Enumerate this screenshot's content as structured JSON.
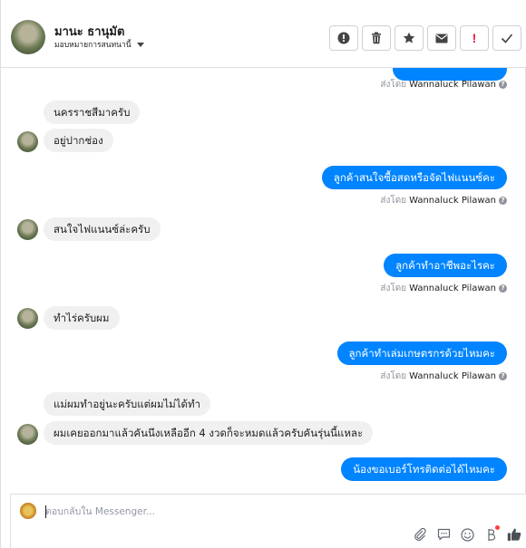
{
  "header": {
    "name": "มานะ ธานุมัต",
    "assign_label": "มอบหมายการสนทนานี้",
    "toolbar_icons": [
      "alert-circle-icon",
      "trash-icon",
      "star-icon",
      "mail-icon",
      "exclamation-icon",
      "checkmark-icon"
    ]
  },
  "messages": [
    {
      "dir": "out",
      "text": ""
    },
    {
      "dir": "meta",
      "prefix": "ส่งโดย",
      "sender": "Wannaluck Pilawan",
      "help": "?"
    },
    {
      "dir": "in",
      "text": "นครราชสีมาครับ"
    },
    {
      "dir": "in",
      "text": "อยู่ปากช่อง"
    },
    {
      "dir": "out",
      "text": "ลูกค้าสนใจซื้อสดหรือจัดไฟแนนซ์คะ"
    },
    {
      "dir": "meta",
      "prefix": "ส่งโดย",
      "sender": "Wannaluck Pilawan",
      "help": "?"
    },
    {
      "dir": "in",
      "text": "สนใจไฟแนนซ์ล่ะครับ"
    },
    {
      "dir": "out",
      "text": "ลูกค้าทำอาชีพอะไรคะ"
    },
    {
      "dir": "meta",
      "prefix": "ส่งโดย",
      "sender": "Wannaluck Pilawan",
      "help": "?"
    },
    {
      "dir": "in",
      "text": "ทำไร่ครับผม"
    },
    {
      "dir": "out",
      "text": "ลูกค้าทำเล่มเกษตรกรด้วยไหมคะ"
    },
    {
      "dir": "meta",
      "prefix": "ส่งโดย",
      "sender": "Wannaluck Pilawan",
      "help": "?"
    },
    {
      "dir": "in",
      "text": "แม่ผมทำอยู่นะครับแต่ผมไม่ได้ทำ"
    },
    {
      "dir": "in",
      "text": "ผมเคยออกมาแล้วคันนึงเหลืออีก 4 งวดก็จะหมดแล้วครับคันรุ่นนี้แหละ"
    },
    {
      "dir": "out",
      "text": "น้องขอเบอร์โทรติดต่อได้ไหมคะ"
    }
  ],
  "composer": {
    "placeholder": "ตอบกลับใน Messenger...",
    "tool_icons": [
      "paperclip-icon",
      "chat-bubble-icon",
      "smiley-icon",
      "bot-icon",
      "thumbs-up-icon"
    ]
  },
  "colors": {
    "outgoing_bubble": "#0084ff",
    "incoming_bubble": "#f1f0f0",
    "meta_text": "#90949c",
    "alert_red": "#e41e3f"
  }
}
